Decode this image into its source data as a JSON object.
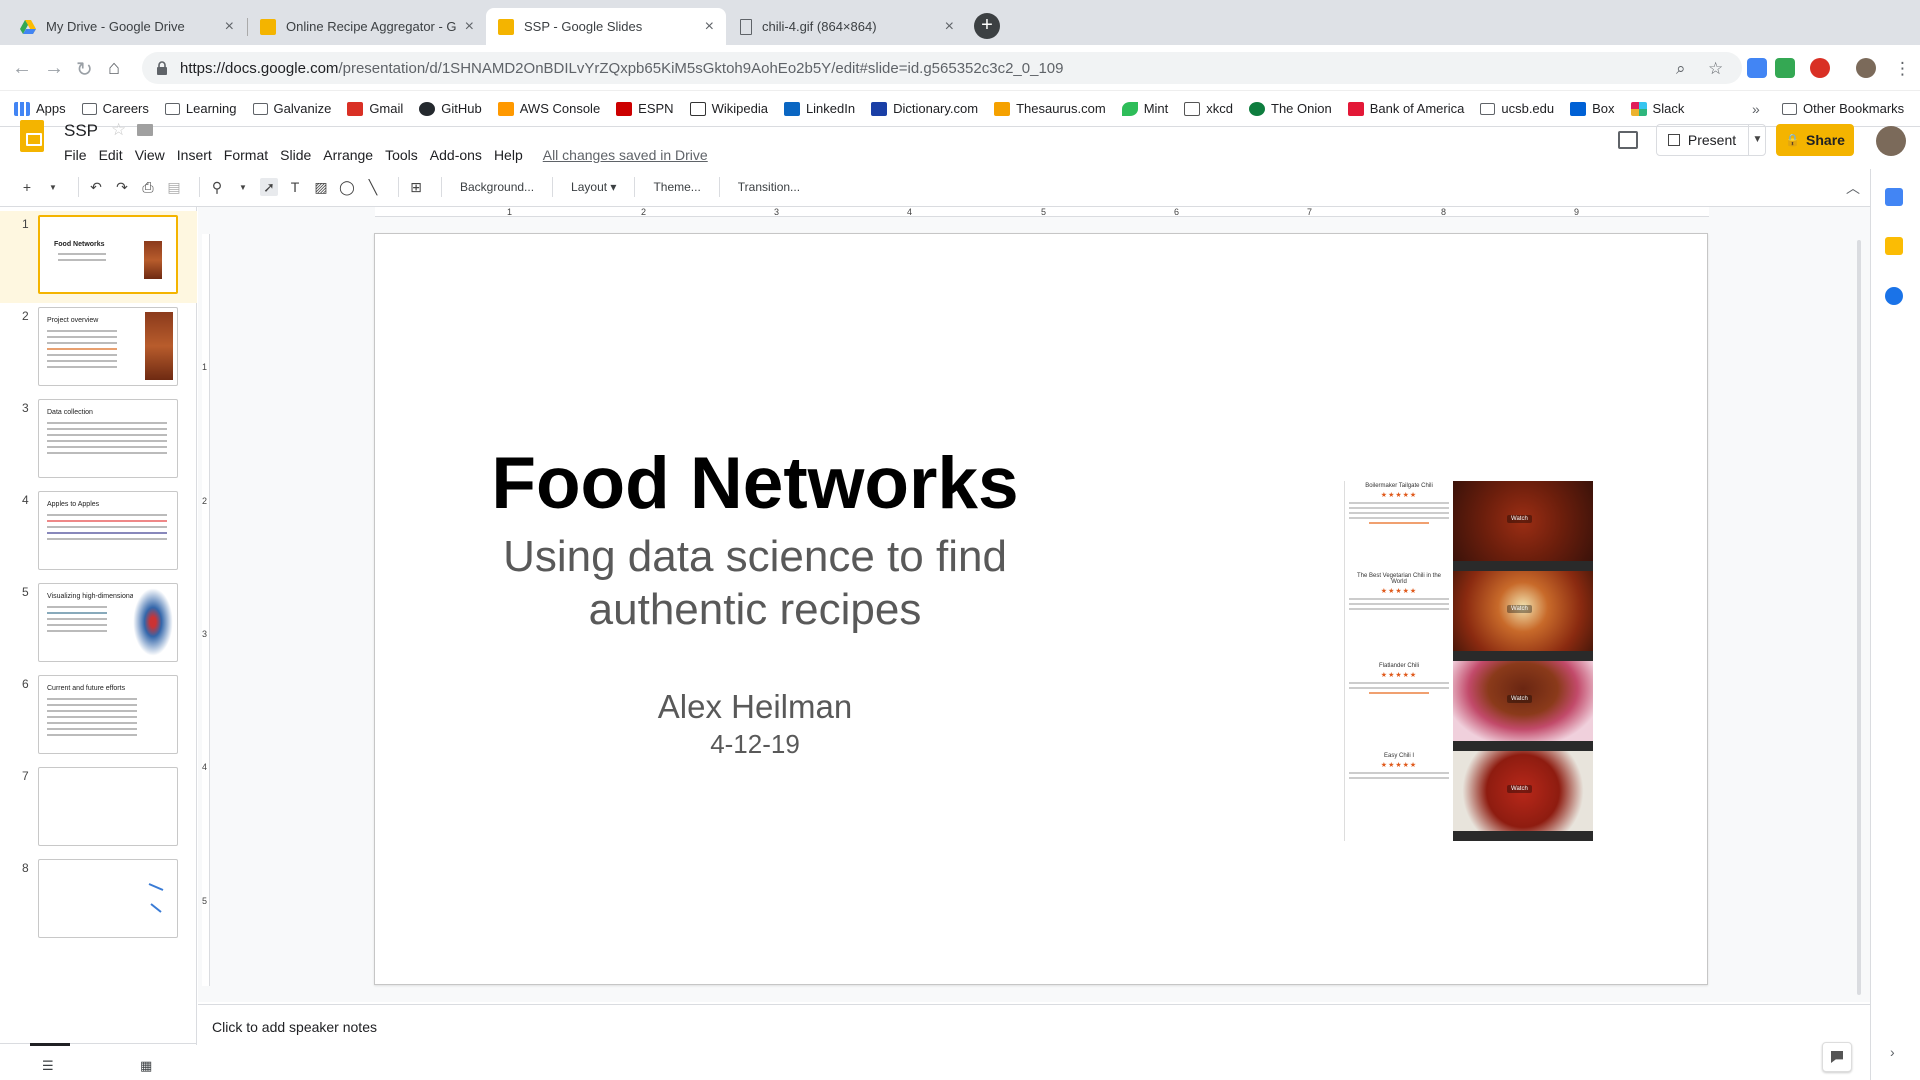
{
  "browser": {
    "tabs": [
      {
        "title": "My Drive - Google Drive",
        "active": false
      },
      {
        "title": "Online Recipe Aggregator - Go",
        "active": false
      },
      {
        "title": "SSP - Google Slides",
        "active": true
      },
      {
        "title": "chili-4.gif (864×864)",
        "active": false
      }
    ],
    "url_host": "https://docs.google.com",
    "url_rest": "/presentation/d/1SHNAMD2OnBDILvYrZQxpb65KiM5sGktoh9AohEo2b5Y/edit#slide=id.g565352c3c2_0_109",
    "bookmarks": [
      "Apps",
      "Careers",
      "Learning",
      "Galvanize",
      "Gmail",
      "GitHub",
      "AWS Console",
      "ESPN",
      "Wikipedia",
      "LinkedIn",
      "Dictionary.com",
      "Thesaurus.com",
      "Mint",
      "xkcd",
      "The Onion",
      "Bank of America",
      "ucsb.edu",
      "Box",
      "Slack"
    ],
    "other_bookmarks": "Other Bookmarks",
    "more": "»"
  },
  "app": {
    "doc_title": "SSP",
    "menu": [
      "File",
      "Edit",
      "View",
      "Insert",
      "Format",
      "Slide",
      "Arrange",
      "Tools",
      "Add-ons",
      "Help"
    ],
    "saved_status": "All changes saved in Drive",
    "present_label": "Present",
    "share_label": "Share"
  },
  "edit_toolbar": {
    "background": "Background...",
    "layout": "Layout",
    "theme": "Theme...",
    "transition": "Transition..."
  },
  "filmstrip": {
    "slides": [
      {
        "num": "1",
        "title": "Food Networks"
      },
      {
        "num": "2",
        "title": "Project overview"
      },
      {
        "num": "3",
        "title": "Data collection"
      },
      {
        "num": "4",
        "title": "Apples to Apples"
      },
      {
        "num": "5",
        "title": "Visualizing high-dimensional data"
      },
      {
        "num": "6",
        "title": "Current and future efforts"
      },
      {
        "num": "7",
        "title": ""
      },
      {
        "num": "8",
        "title": ""
      }
    ]
  },
  "ruler": {
    "top": [
      "1",
      "2",
      "3",
      "4",
      "5",
      "6",
      "7",
      "8",
      "9"
    ],
    "left": [
      "1",
      "2",
      "3",
      "4",
      "5"
    ]
  },
  "slide": {
    "title": "Food Networks",
    "subtitle": "Using data science to find authentic recipes",
    "author": "Alex Heilman",
    "date": "4-12-19",
    "recipes": [
      {
        "name": "Boilermaker Tailgate Chili",
        "stars": "★★★★★"
      },
      {
        "name": "The Best Vegetarian Chili in the World",
        "stars": "★★★★★"
      },
      {
        "name": "Flatlander Chili",
        "stars": "★★★★★"
      },
      {
        "name": "Easy Chili I",
        "stars": "★★★★★"
      }
    ],
    "watch_label": "Watch"
  },
  "notes": {
    "placeholder": "Click to add speaker notes"
  }
}
